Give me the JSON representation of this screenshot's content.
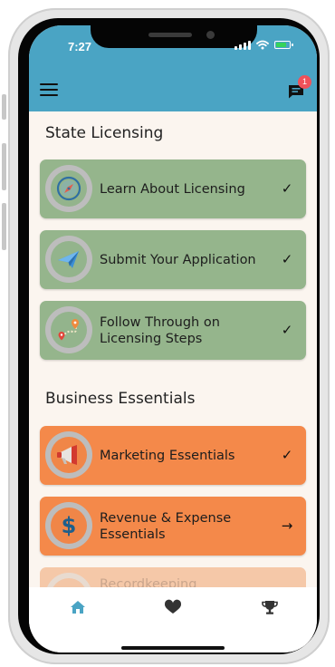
{
  "status_bar": {
    "time": "7:27"
  },
  "header": {
    "notification_count": "1"
  },
  "sections": [
    {
      "title": "State Licensing",
      "items": [
        {
          "label": "Learn About Licensing",
          "action_icon": "check",
          "icon": "compass-icon"
        },
        {
          "label": "Submit Your Application",
          "action_icon": "check",
          "icon": "paper-plane-icon"
        },
        {
          "label": "Follow Through on Licensing Steps",
          "action_icon": "check",
          "icon": "route-map-icon"
        }
      ]
    },
    {
      "title": "Business Essentials",
      "items": [
        {
          "label": "Marketing Essentials",
          "action_icon": "check",
          "icon": "megaphone-icon"
        },
        {
          "label": "Revenue & Expense Essentials",
          "action_icon": "arrow-right",
          "icon": "dollar-icon"
        },
        {
          "label": "Recordkeeping",
          "action_icon": "",
          "icon": "ledger-icon"
        }
      ]
    }
  ],
  "colors": {
    "header": "#4aa4c4",
    "licensing_card": "#95b58c",
    "essentials_card": "#f4894a",
    "faded_card": "#f5c8a8",
    "tab_active": "#4aa4c4",
    "tab_inactive": "#333333"
  },
  "tabs": [
    {
      "name": "home",
      "icon": "home-icon",
      "active": true
    },
    {
      "name": "favorites",
      "icon": "heart-icon",
      "active": false
    },
    {
      "name": "achievements",
      "icon": "trophy-icon",
      "active": false
    }
  ]
}
